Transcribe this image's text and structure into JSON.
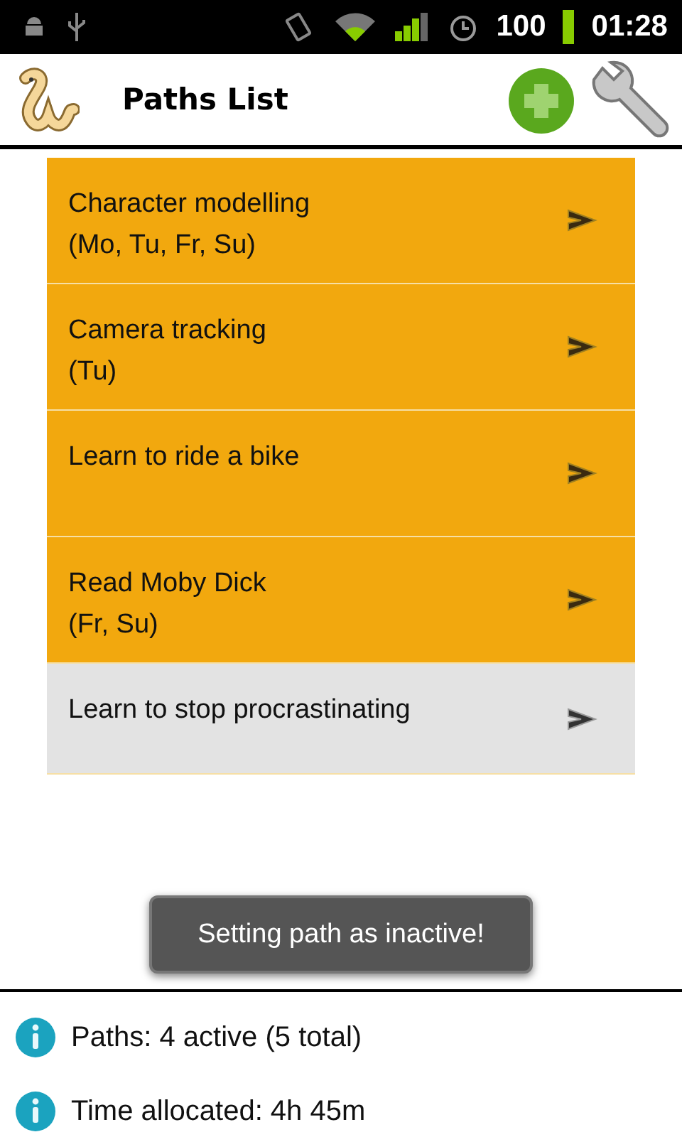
{
  "status_bar": {
    "battery": "100",
    "time": "01:28"
  },
  "header": {
    "title": "Paths List"
  },
  "paths": [
    {
      "name": "Character modelling",
      "days": "(Mo, Tu, Fr, Su)",
      "active": true
    },
    {
      "name": "Camera tracking",
      "days": "(Tu)",
      "active": true
    },
    {
      "name": "Learn to ride a bike",
      "active": true
    },
    {
      "name": "Read Moby Dick",
      "days": "(Fr, Su)",
      "active": true
    },
    {
      "name": "Learn to stop procrastinating",
      "active": false
    }
  ],
  "toast": "Setting path as inactive!",
  "summary": [
    "Paths: 4 active (5 total)",
    "Time allocated: 4h 45m"
  ]
}
